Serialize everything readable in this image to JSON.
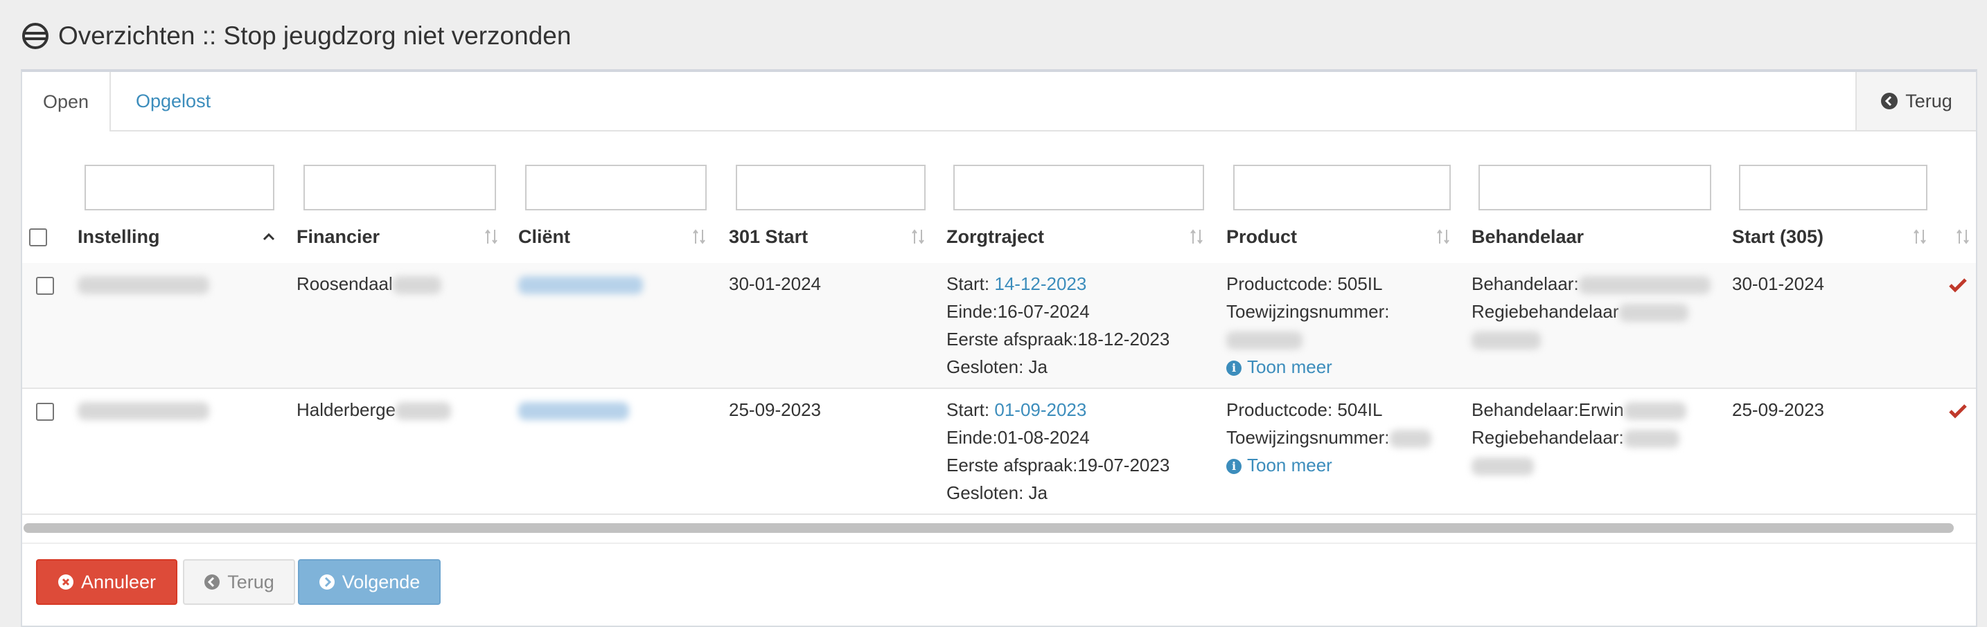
{
  "page": {
    "title": "Overzichten :: Stop jeugdzorg niet verzonden"
  },
  "tabs": {
    "open": "Open",
    "resolved": "Opgelost",
    "back": "Terug"
  },
  "columns": {
    "instelling": "Instelling",
    "financier": "Financier",
    "client": "Cliënt",
    "start301": "301 Start",
    "zorgtraject": "Zorgtraject",
    "product": "Product",
    "behandelaar": "Behandelaar",
    "start305": "Start (305)"
  },
  "rows": [
    {
      "financier": "Roosendaal",
      "start301": "30-01-2024",
      "zt_start_label": "Start: ",
      "zt_start_date": "14-12-2023",
      "zt_einde": "Einde:16-07-2024",
      "zt_eerste": "Eerste afspraak:18-12-2023",
      "zt_gesloten": "Gesloten: Ja",
      "productcode": "Productcode: 505IL",
      "toewijzing": "Toewijzingsnummer:",
      "toon_meer": "Toon meer",
      "behandelaar": "Behandelaar:",
      "regie": "Regiebehandelaar",
      "start305": "30-01-2024"
    },
    {
      "financier": "Halderberge",
      "start301": "25-09-2023",
      "zt_start_label": "Start: ",
      "zt_start_date": "01-09-2023",
      "zt_einde": "Einde:01-08-2024",
      "zt_eerste": "Eerste afspraak:19-07-2023",
      "zt_gesloten": "Gesloten: Ja",
      "productcode": "Productcode: 504IL",
      "toewijzing": "Toewijzingsnummer:",
      "toon_meer": "Toon meer",
      "behandelaar": "Behandelaar:Erwin",
      "regie": "Regiebehandelaar:",
      "start305": "25-09-2023"
    }
  ],
  "buttons": {
    "cancel": "Annuleer",
    "back": "Terug",
    "next": "Volgende"
  },
  "colors": {
    "link": "#3c8dbc",
    "danger": "#dd4b39",
    "primary_disabled": "#7fb3d9",
    "check": "#c0392b"
  }
}
